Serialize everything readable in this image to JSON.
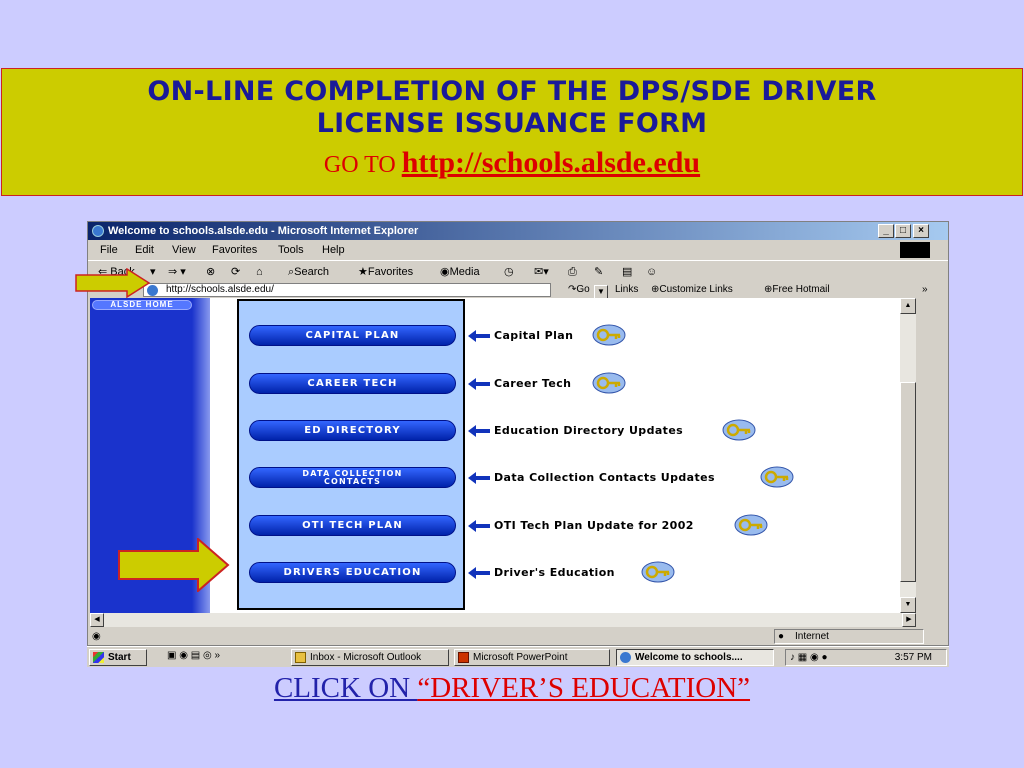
{
  "slide": {
    "title_line1": "ON-LINE COMPLETION OF THE DPS/SDE DRIVER",
    "title_line2": "LICENSE ISSUANCE FORM",
    "goto_label": "GO TO ",
    "goto_url": "http://schools.alsde.edu",
    "instruction_click": "CLICK ON ",
    "instruction_target": "“DRIVER’S EDUCATION”"
  },
  "browser": {
    "window_title": "Welcome to schools.alsde.edu - Microsoft Internet Explorer",
    "controls": {
      "minimize": "_",
      "maximize": "□",
      "close": "×"
    },
    "menu": [
      "File",
      "Edit",
      "View",
      "Favorites",
      "Tools",
      "Help"
    ],
    "toolbar": {
      "back": "⇐ Back",
      "search": "Search",
      "favorites": "Favorites",
      "media": "Media"
    },
    "address": {
      "url": "http://schools.alsde.edu/",
      "go": "Go",
      "links": "Links",
      "customize_links": "Customize Links",
      "free_hotmail": "Free Hotmail"
    },
    "status_zone": "Internet"
  },
  "page": {
    "home_button": "ALSDE HOME",
    "buttons": [
      {
        "label": "CAPITAL PLAN",
        "description": "Capital Plan"
      },
      {
        "label": "CAREER TECH",
        "description": "Career Tech"
      },
      {
        "label": "ED DIRECTORY",
        "description": "Education Directory Updates"
      },
      {
        "label": "DATA COLLECTION CONTACTS",
        "label_line1": "DATA COLLECTION",
        "label_line2": "CONTACTS",
        "description": "Data Collection Contacts Updates"
      },
      {
        "label": "OTI TECH PLAN",
        "description": "OTI Tech Plan Update for 2002"
      },
      {
        "label": "DRIVERS EDUCATION",
        "description": "Driver's Education"
      }
    ]
  },
  "taskbar": {
    "start": "Start",
    "tasks": [
      "Inbox - Microsoft Outlook",
      "Microsoft PowerPoint",
      "Welcome to schools...."
    ],
    "clock": "3:57 PM"
  },
  "colors": {
    "background": "#ccccff",
    "title_box": "#cccc00",
    "title_text": "#1a1a99",
    "accent_red": "#dd0000",
    "pill_blue": "#0033cc",
    "arrow_yellow": "#cccc00"
  }
}
